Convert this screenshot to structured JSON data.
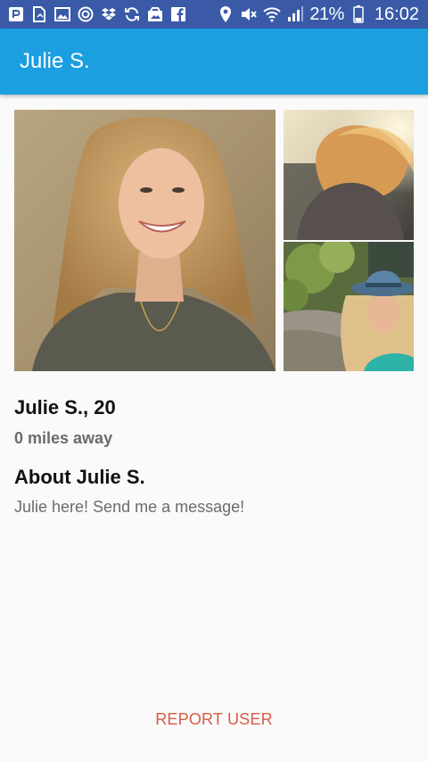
{
  "status_bar": {
    "left_icons": [
      "p-app-icon",
      "document-icon",
      "image-icon",
      "circle-swirl-icon",
      "dropbox-icon",
      "sync-icon",
      "photos-icon",
      "facebook-icon"
    ],
    "right_icons": [
      "location-icon",
      "mute-icon",
      "wifi-icon",
      "signal-icon"
    ],
    "battery_percent": "21%",
    "time": "16:02",
    "background_color": "#3a5aa8"
  },
  "app_bar": {
    "title": "Julie S.",
    "background_color": "#1b9fe0"
  },
  "profile": {
    "name_age": "Julie S., 20",
    "distance": "0 miles away",
    "about_heading": "About Julie S.",
    "about_text": "Julie here! Send me a message!"
  },
  "photos": [
    "main-profile-photo",
    "windblown-hair-photo",
    "blue-hat-photo"
  ],
  "actions": {
    "report_label": "REPORT USER",
    "report_color": "#d95a45"
  }
}
